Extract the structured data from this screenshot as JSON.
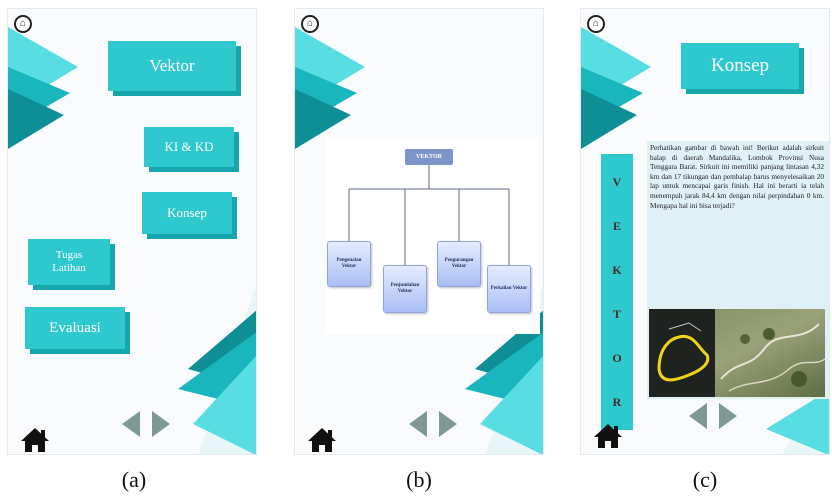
{
  "colors": {
    "accent": "#2ec8cf",
    "accent_dark": "#16a6ab",
    "teal_deep": "#0e8f96",
    "diagram_header": "#7d95c9"
  },
  "icons": {
    "top_home": "home-circle-icon",
    "bottom_home": "house-icon",
    "prev": "triangle-left-icon",
    "next": "triangle-right-icon"
  },
  "panels": [
    {
      "caption": "(a)",
      "menu": {
        "vektor": "Vektor",
        "ki_kd": "KI & KD",
        "konsep": "Konsep",
        "tugas_latihan": "Tugas\nLatihan",
        "evaluasi": "Evaluasi"
      }
    },
    {
      "caption": "(b)",
      "diagram": {
        "root": "VEKTOR",
        "children": [
          "Pengenalan Vektor",
          "Penjumlahan Vektor",
          "Pengurangan Vektor",
          "Perkalian Vektor"
        ]
      }
    },
    {
      "caption": "(c)",
      "title": "Konsep",
      "side_letters": [
        "V",
        "E",
        "K",
        "T",
        "O",
        "R"
      ],
      "paragraph": "Perhatikan gambar di bawah ini! Berikut adalah sirkuit balap di daerah Mandalika, Lombok Provinsi Nusa Tenggara Barat. Sirkuit ini memiliki panjang lintasan 4,32 km dan 17 tikungan dan pembalap harus menyelesaikan 20 lap untuk mencapai garis finish. Hal ini berarti ia telah menempuh jarak 84,4 km dengan nilai perpindahan 0 km. Mengapa hal ini bisa terjadi?"
    }
  ]
}
